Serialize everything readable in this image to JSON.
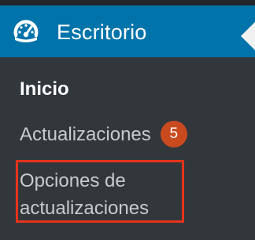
{
  "menu": {
    "title": "Escritorio",
    "icon": "dashboard-gauge-icon",
    "accent_color": "#0073aa"
  },
  "submenu": {
    "home_label": "Inicio",
    "updates_label": "Actualizaciones",
    "updates_count": "5",
    "options_label": "Opciones de actualizaciones"
  },
  "colors": {
    "badge": "#ca4a1f",
    "highlight": "#e8331c",
    "sidebar_bg": "#32373c"
  }
}
